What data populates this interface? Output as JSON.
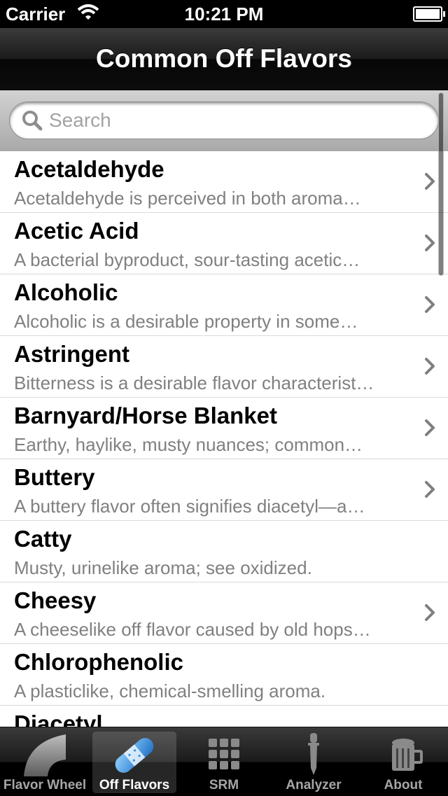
{
  "status": {
    "carrier": "Carrier",
    "time": "10:21 PM"
  },
  "nav": {
    "title": "Common Off Flavors"
  },
  "search": {
    "placeholder": "Search",
    "value": ""
  },
  "rows": [
    {
      "name": "Acetaldehyde",
      "desc": "Acetaldehyde is perceived in both aroma…",
      "chevron": true
    },
    {
      "name": "Acetic Acid",
      "desc": "A bacterial byproduct, sour-tasting acetic…",
      "chevron": true
    },
    {
      "name": "Alcoholic",
      "desc": "Alcoholic is a desirable property in some…",
      "chevron": true
    },
    {
      "name": "Astringent",
      "desc": "Bitterness is a desirable flavor characterist…",
      "chevron": true
    },
    {
      "name": "Barnyard/Horse Blanket",
      "desc": "Earthy, haylike, musty nuances; common…",
      "chevron": true
    },
    {
      "name": "Buttery",
      "desc": "A buttery flavor often signifies diacetyl—a…",
      "chevron": true
    },
    {
      "name": "Catty",
      "desc": "Musty, urinelike aroma; see oxidized.",
      "chevron": false
    },
    {
      "name": "Cheesy",
      "desc": "A cheeselike off flavor caused by old hops…",
      "chevron": true
    },
    {
      "name": "Chlorophenolic",
      "desc": "A plasticlike, chemical-smelling aroma.",
      "chevron": false
    },
    {
      "name": "Diacetyl",
      "desc": "",
      "chevron": false
    }
  ],
  "tabs": [
    {
      "label": "Flavor Wheel",
      "icon": "flavor-wheel-icon",
      "selected": false
    },
    {
      "label": "Off Flavors",
      "icon": "bandage-icon",
      "selected": true
    },
    {
      "label": "SRM",
      "icon": "grid-icon",
      "selected": false
    },
    {
      "label": "Analyzer",
      "icon": "dropper-icon",
      "selected": false
    },
    {
      "label": "About",
      "icon": "beer-mug-icon",
      "selected": false
    }
  ],
  "colors": {
    "selected_tab_icon": "#3c8fd8",
    "chevron": "#7f7f7f",
    "subtitle": "#808080"
  }
}
